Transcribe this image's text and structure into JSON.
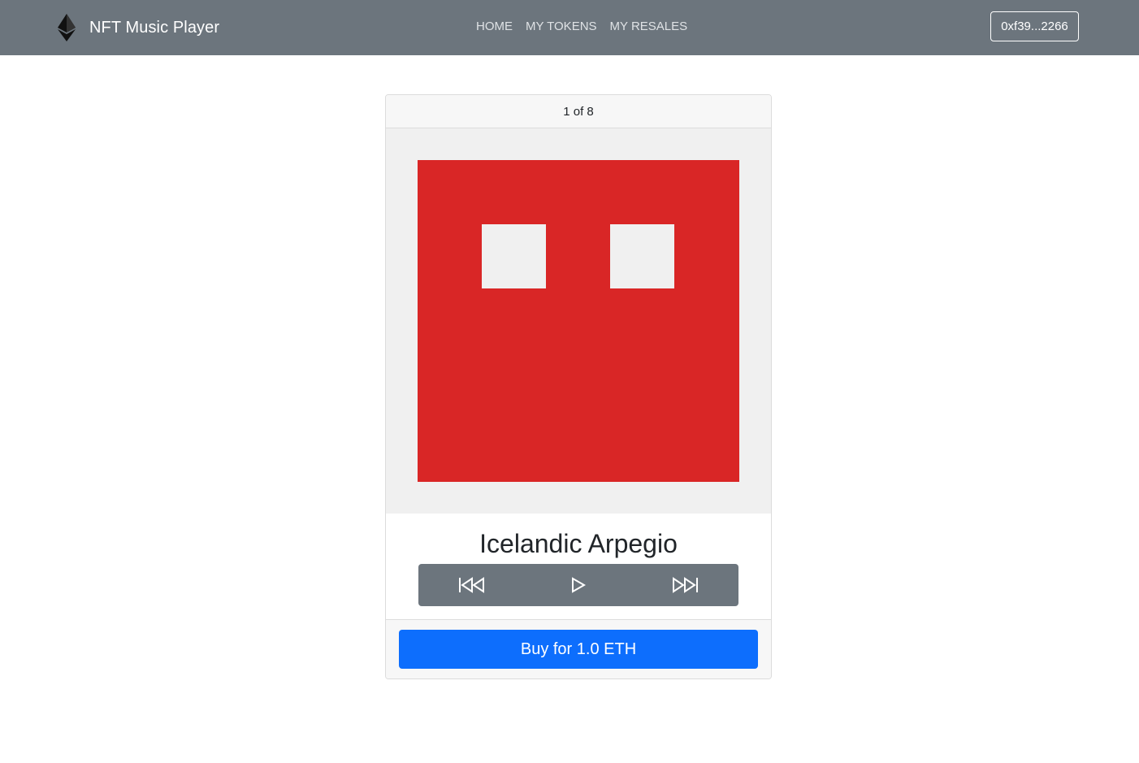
{
  "navbar": {
    "brand_logo": "ethereum-logo-icon",
    "brand_title": "NFT Music Player",
    "links": [
      "HOME",
      "MY TOKENS",
      "MY RESALES"
    ],
    "account": "0xf39...2266",
    "bg_color": "#6c757d"
  },
  "card": {
    "header": "1 of 8",
    "artwork": {
      "description_icon": "nft-artwork-icon",
      "main_color": "#d92626",
      "bg_color": "#f0f0f0"
    },
    "title": "Icelandic Arpegio",
    "controls": {
      "icons": [
        "skip-back-icon",
        "play-icon",
        "skip-forward-icon"
      ]
    },
    "buy_label": "Buy for 1.0 ETH",
    "buy_color": "#0d6efd"
  }
}
